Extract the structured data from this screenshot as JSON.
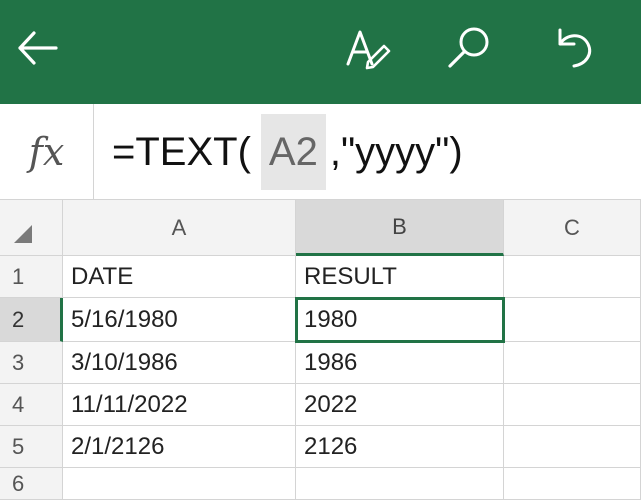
{
  "toolbar": {
    "back_icon": "arrow-left-icon",
    "format_icon": "text-format-pen-icon",
    "search_icon": "search-icon",
    "undo_icon": "undo-icon",
    "bar_color": "#217346"
  },
  "formula_bar": {
    "label": "fx",
    "prefix": "=TEXT(",
    "reference": "A2",
    "suffix": ",\"yyyy\")"
  },
  "sheet": {
    "columns": [
      "A",
      "B",
      "C"
    ],
    "selected_column": "B",
    "rows": [
      {
        "num": "1",
        "a": "DATE",
        "b": "RESULT",
        "c": ""
      },
      {
        "num": "2",
        "a": "5/16/1980",
        "b": "1980",
        "c": ""
      },
      {
        "num": "3",
        "a": "3/10/1986",
        "b": "1986",
        "c": ""
      },
      {
        "num": "4",
        "a": "11/11/2022",
        "b": "2022",
        "c": ""
      },
      {
        "num": "5",
        "a": "2/1/2126",
        "b": "2126",
        "c": ""
      },
      {
        "num": "6",
        "a": "",
        "b": "",
        "c": ""
      }
    ],
    "active_cell": "B2",
    "accent_color": "#217346"
  }
}
